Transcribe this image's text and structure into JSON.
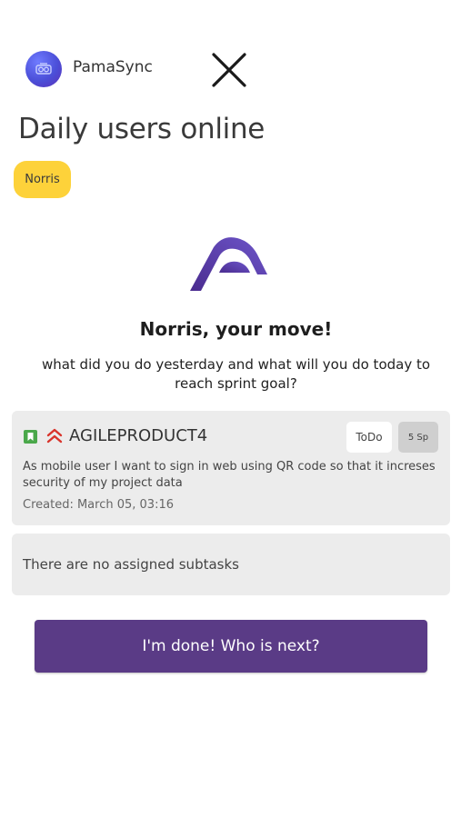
{
  "header": {
    "app_name": "PamaSync",
    "logo_icon": "pamasync-logo-icon",
    "close_icon": "close-icon"
  },
  "page_title": "Daily users online",
  "users": [
    {
      "name": "Norris",
      "color": "#fdd23a"
    }
  ],
  "turn": {
    "title": "Norris, your move!",
    "prompt": "what did you do yesterday and what will you do today to reach sprint goal?"
  },
  "task": {
    "type_icon": "story-icon",
    "priority_icon": "high-priority-icon",
    "key": "AGILEPRODUCT4",
    "status": "ToDo",
    "points": "5 Sp",
    "description": "As mobile user I want to sign in web using QR code so that it increses security of my project data",
    "created": "Created: March 05, 03:16"
  },
  "subtasks": {
    "empty_text": "There are no assigned subtasks"
  },
  "actions": {
    "done_label": "I'm done! Who is next?"
  },
  "colors": {
    "accent": "#5a3b86",
    "chip": "#fdd23a",
    "card_bg": "#ececec",
    "story": "#4aa84a",
    "priority": "#d9342b"
  }
}
